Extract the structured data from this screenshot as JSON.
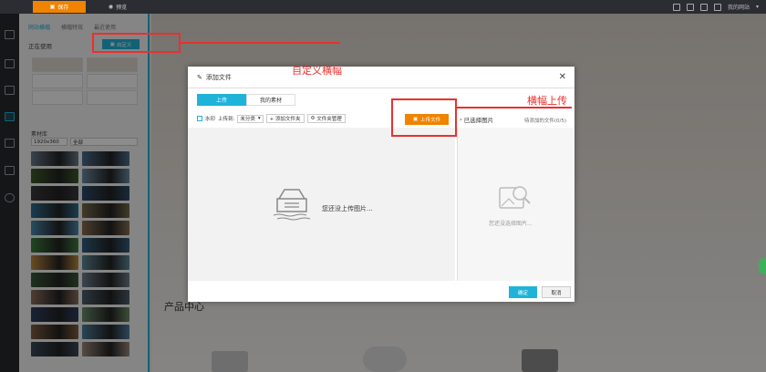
{
  "topbar": {
    "save_label": "保存",
    "preview_label": "预览",
    "account_label": "我的网站"
  },
  "panel": {
    "tabs": [
      "网站横幅",
      "横幅特效",
      "最近使用"
    ],
    "in_use_label": "正在使用",
    "custom_button_label": "自定义",
    "library_label": "素材库",
    "size_select": "1920x360",
    "type_select": "全部"
  },
  "canvas": {
    "product_title": "产品中心"
  },
  "modal": {
    "title": "添加文件",
    "tabs": [
      "上传",
      "我的素材"
    ],
    "watermark_label": "水印",
    "upload_to_label": "上传到:",
    "category_select": "未分类",
    "add_folder_label": "+ 添加文件夹",
    "folder_manage_label": "文件夹管理",
    "upload_button_label": "上传文件",
    "selected_label": "已选择图片",
    "pending_label": "待添加的文件(0/5)",
    "empty_upload": "您还没上传图片...",
    "empty_selected": "您还没选择图片...",
    "ok_label": "确定",
    "cancel_label": "取消"
  },
  "annotations": {
    "custom_banner": "自定义横幅",
    "banner_upload": "横幅上传"
  },
  "colors": {
    "accent": "#1fb3d9",
    "orange": "#f08300",
    "annotation": "#e8312f"
  },
  "thumbnail_colors": [
    "#6b7a8a",
    "#4a6f8e",
    "#3f5b2a",
    "#6c8ba3",
    "#3a3a3a",
    "#2d4b6b",
    "#2f6f8f",
    "#7a6a4a",
    "#4a8bb0",
    "#8a7050",
    "#3f7f3f",
    "#345f7f",
    "#c08a40",
    "#5f8a9a",
    "#3b5b3b",
    "#6f7f8f",
    "#8f6f5f",
    "#4f5f6f",
    "#2f3f5f",
    "#6a8f6a",
    "#7f5f3f",
    "#4f7f9f",
    "#3a4a5a",
    "#9a8a7a"
  ]
}
